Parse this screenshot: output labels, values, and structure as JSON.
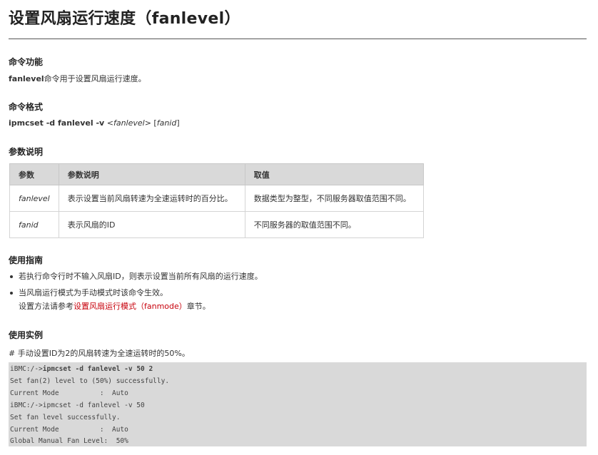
{
  "title": "设置风扇运行速度（fanlevel）",
  "sections": {
    "function": {
      "heading": "命令功能",
      "cmd": "fanlevel",
      "text": "命令用于设置风扇运行速度。"
    },
    "format": {
      "heading": "命令格式",
      "cmd": "ipmcset -d fanlevel -v",
      "arg1": "fanlevel",
      "arg2": "fanid"
    },
    "params": {
      "heading": "参数说明",
      "headers": [
        "参数",
        "参数说明",
        "取值"
      ],
      "rows": [
        {
          "param": "fanlevel",
          "desc": "表示设置当前风扇转速为全速运转时的百分比。",
          "value": "数据类型为整型，不同服务器取值范围不同。"
        },
        {
          "param": "fanid",
          "desc": "表示风扇的ID",
          "value": "不同服务器的取值范围不同。"
        }
      ]
    },
    "guide": {
      "heading": "使用指南",
      "item1": "若执行命令行时不输入风扇ID，则表示设置当前所有风扇的运行速度。",
      "item2_line1": "当风扇运行模式为手动模式时该命令生效。",
      "item2_prefix": "设置方法请参考",
      "item2_link": "设置风扇运行模式（fanmode）",
      "item2_suffix": "章节。"
    },
    "example": {
      "heading": "使用实例",
      "comment": "# 手动设置ID为2的风扇转速为全速运转时的50%。",
      "code": {
        "l1_prompt": "iBMC:/->",
        "l1_cmd": "ipmcset -d fanlevel -v 50 2",
        "l2": "Set fan(2) level to (50%) successfully.",
        "l3": "Current Mode          :  Auto",
        "l4": "iBMC:/->ipmcset -d fanlevel -v 50",
        "l5": "Set fan level successfully.",
        "l6": "Current Mode          :  Auto",
        "l7": "Global Manual Fan Level:  50%"
      }
    }
  },
  "colors": {
    "link": "#c7000b",
    "table_header": "#d9d9d9",
    "code_bg": "#d9d9d9"
  }
}
